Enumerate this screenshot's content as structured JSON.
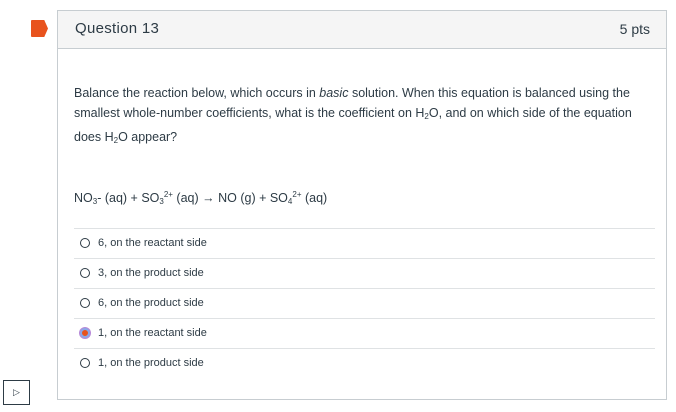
{
  "question": {
    "title": "Question 13",
    "points": "5 pts",
    "text_before": "Balance the reaction below, which occurs in ",
    "text_emph": "basic",
    "text_mid": " solution. When this equation is balanced using the smallest whole-number coefficients, what is the coefficient on H",
    "h2o_sub": "2",
    "text_mid2": "O, and on which side of the equation does H",
    "h2o_sub2": "2",
    "text_end": "O appear?"
  },
  "equation": {
    "no3": "NO",
    "no3_sub": "3",
    "no3_rest": "- (aq) + SO",
    "so3_sub": "3",
    "so3_sup": "2+",
    "mid": " (aq) → NO (g) + SO",
    "so4_sub": "4",
    "so4_sup": "2+",
    "end": " (aq)"
  },
  "answers": [
    {
      "label": "6, on the reactant side",
      "selected": false
    },
    {
      "label": "3, on the product side",
      "selected": false
    },
    {
      "label": "6, on the product side",
      "selected": false
    },
    {
      "label": "1, on the reactant side",
      "selected": true
    },
    {
      "label": "1, on the product side",
      "selected": false
    }
  ],
  "icons": {
    "flag": "flag-icon",
    "play": "play-icon"
  },
  "colors": {
    "flag": "#e8531d",
    "selected_radio": "#e8531d",
    "header_bg": "#f5f5f5"
  }
}
